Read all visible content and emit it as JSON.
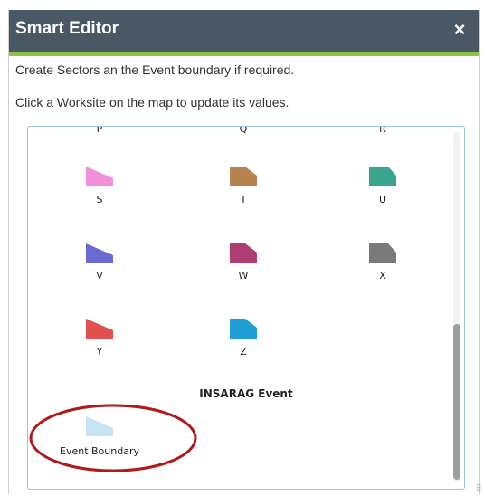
{
  "panel": {
    "title": "Smart Editor",
    "close_icon": "×",
    "instruction_1": "Create Sectors an the Event boundary if required.",
    "instruction_2": "Click a Worksite on the map to update its values."
  },
  "colors": {
    "titlebar": "#4a5866",
    "accent": "#8bc53f",
    "annotation": "#b01a1a"
  },
  "templates": {
    "partial_row": [
      "P",
      "Q",
      "R"
    ],
    "items": [
      {
        "label": "S",
        "color": "#f28fd9"
      },
      {
        "label": "T",
        "color": "#b9834f"
      },
      {
        "label": "U",
        "color": "#3aa58f"
      },
      {
        "label": "V",
        "color": "#6b6ad2"
      },
      {
        "label": "W",
        "color": "#ad3d73"
      },
      {
        "label": "X",
        "color": "#7a7a7a"
      },
      {
        "label": "Y",
        "color": "#e24f4f"
      },
      {
        "label": "Z",
        "color": "#1fa0d4"
      }
    ],
    "group_header": "INSARAG Event",
    "event_boundary": {
      "label": "Event Boundary",
      "color": "#c5e3f2"
    }
  }
}
